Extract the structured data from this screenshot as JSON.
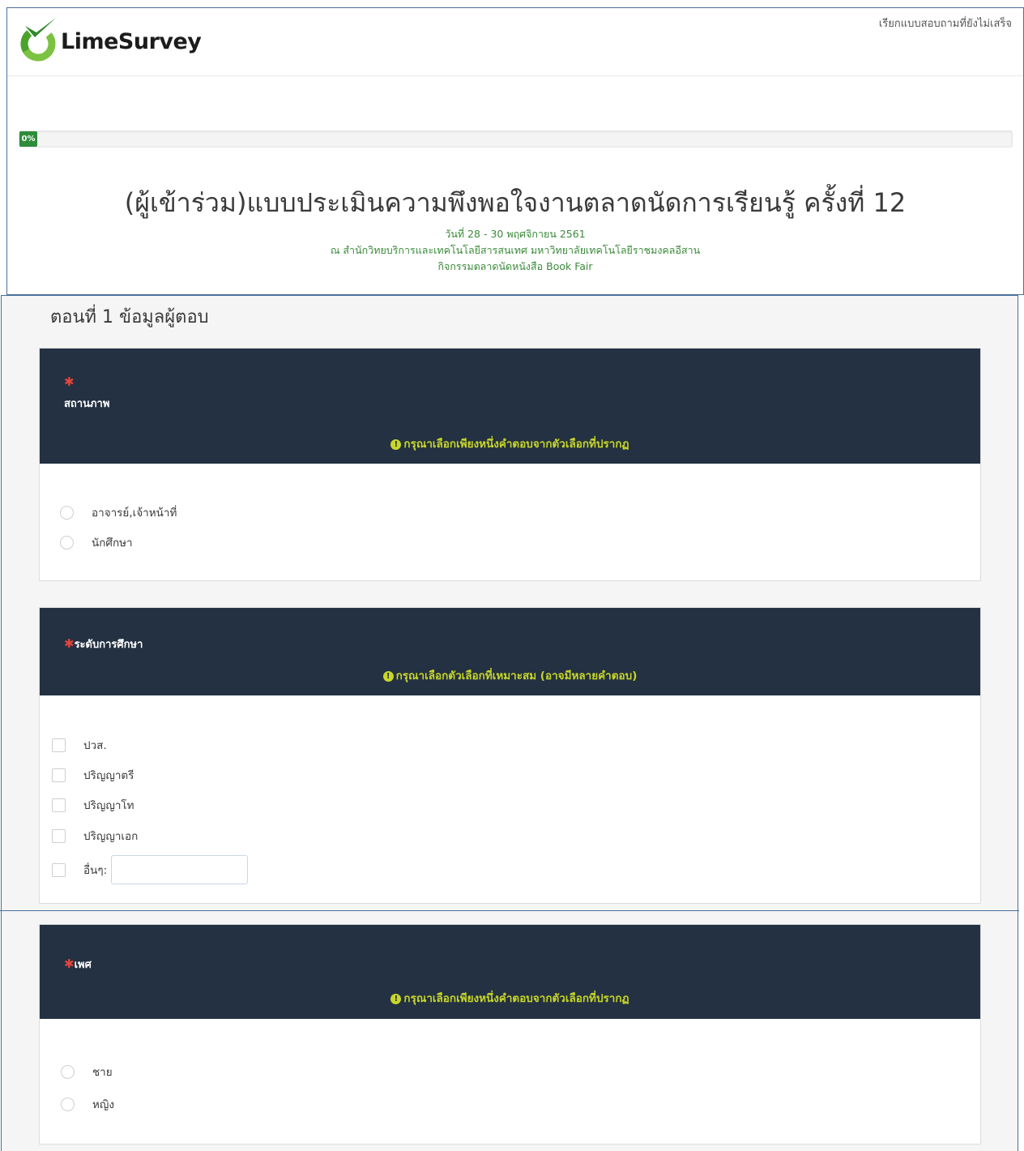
{
  "header": {
    "logo_text": "LimeSurvey",
    "resume_link": "เรียกแบบสอบถามที่ยังไม่เสร็จ"
  },
  "progress": {
    "value_percent": 0,
    "label": "0%"
  },
  "survey": {
    "title": "(ผู้เข้าร่วม)แบบประเมินความพึงพอใจงานตลาดนัดการเรียนรู้ ครั้งที่ 12",
    "date_line": "วันที่ 28 - 30 พฤศจิกายน  2561",
    "venue_line": "ณ สำนักวิทยบริการและเทคโนโลยีสารสนเทศ มหาวิทยาลัยเทคโนโลยีราชมงคลอีสาน",
    "activity_line": "กิจกรรมตลาดนัดหนังสือ Book Fair"
  },
  "section": {
    "title": "ตอนที่ 1 ข้อมูลผู้ตอบ"
  },
  "questions": {
    "status": {
      "mandatory_mark": "✱",
      "label": "สถานภาพ",
      "help": "กรุณาเลือกเพียงหนึ่งคำตอบจากตัวเลือกที่ปรากฏ",
      "options": [
        "อาจารย์,เจ้าหน้าที่",
        "นักศึกษา"
      ]
    },
    "education": {
      "mandatory_mark": "✱",
      "label": "ระดับการศึกษา",
      "help": "กรุณาเลือกตัวเลือกที่เหมาะสม (อาจมีหลายคำตอบ)",
      "options": [
        "ปวส.",
        "ปริญญาตรี",
        "ปริญญาโท",
        "ปริญญาเอก",
        "อื่นๆ:"
      ],
      "other_value": ""
    },
    "gender": {
      "mandatory_mark": "✱",
      "label": "เพศ",
      "help": "กรุณาเลือกเพียงหนึ่งคำตอบจากตัวเลือกที่ปรากฏ",
      "options": [
        "ชาย",
        "หญิง"
      ]
    }
  },
  "colors": {
    "question_header_bg": "#233142",
    "help_text": "#c8d629",
    "mandatory": "#e2453c",
    "progress": "#2e8b3a",
    "subtitle": "#3b8a3b"
  }
}
